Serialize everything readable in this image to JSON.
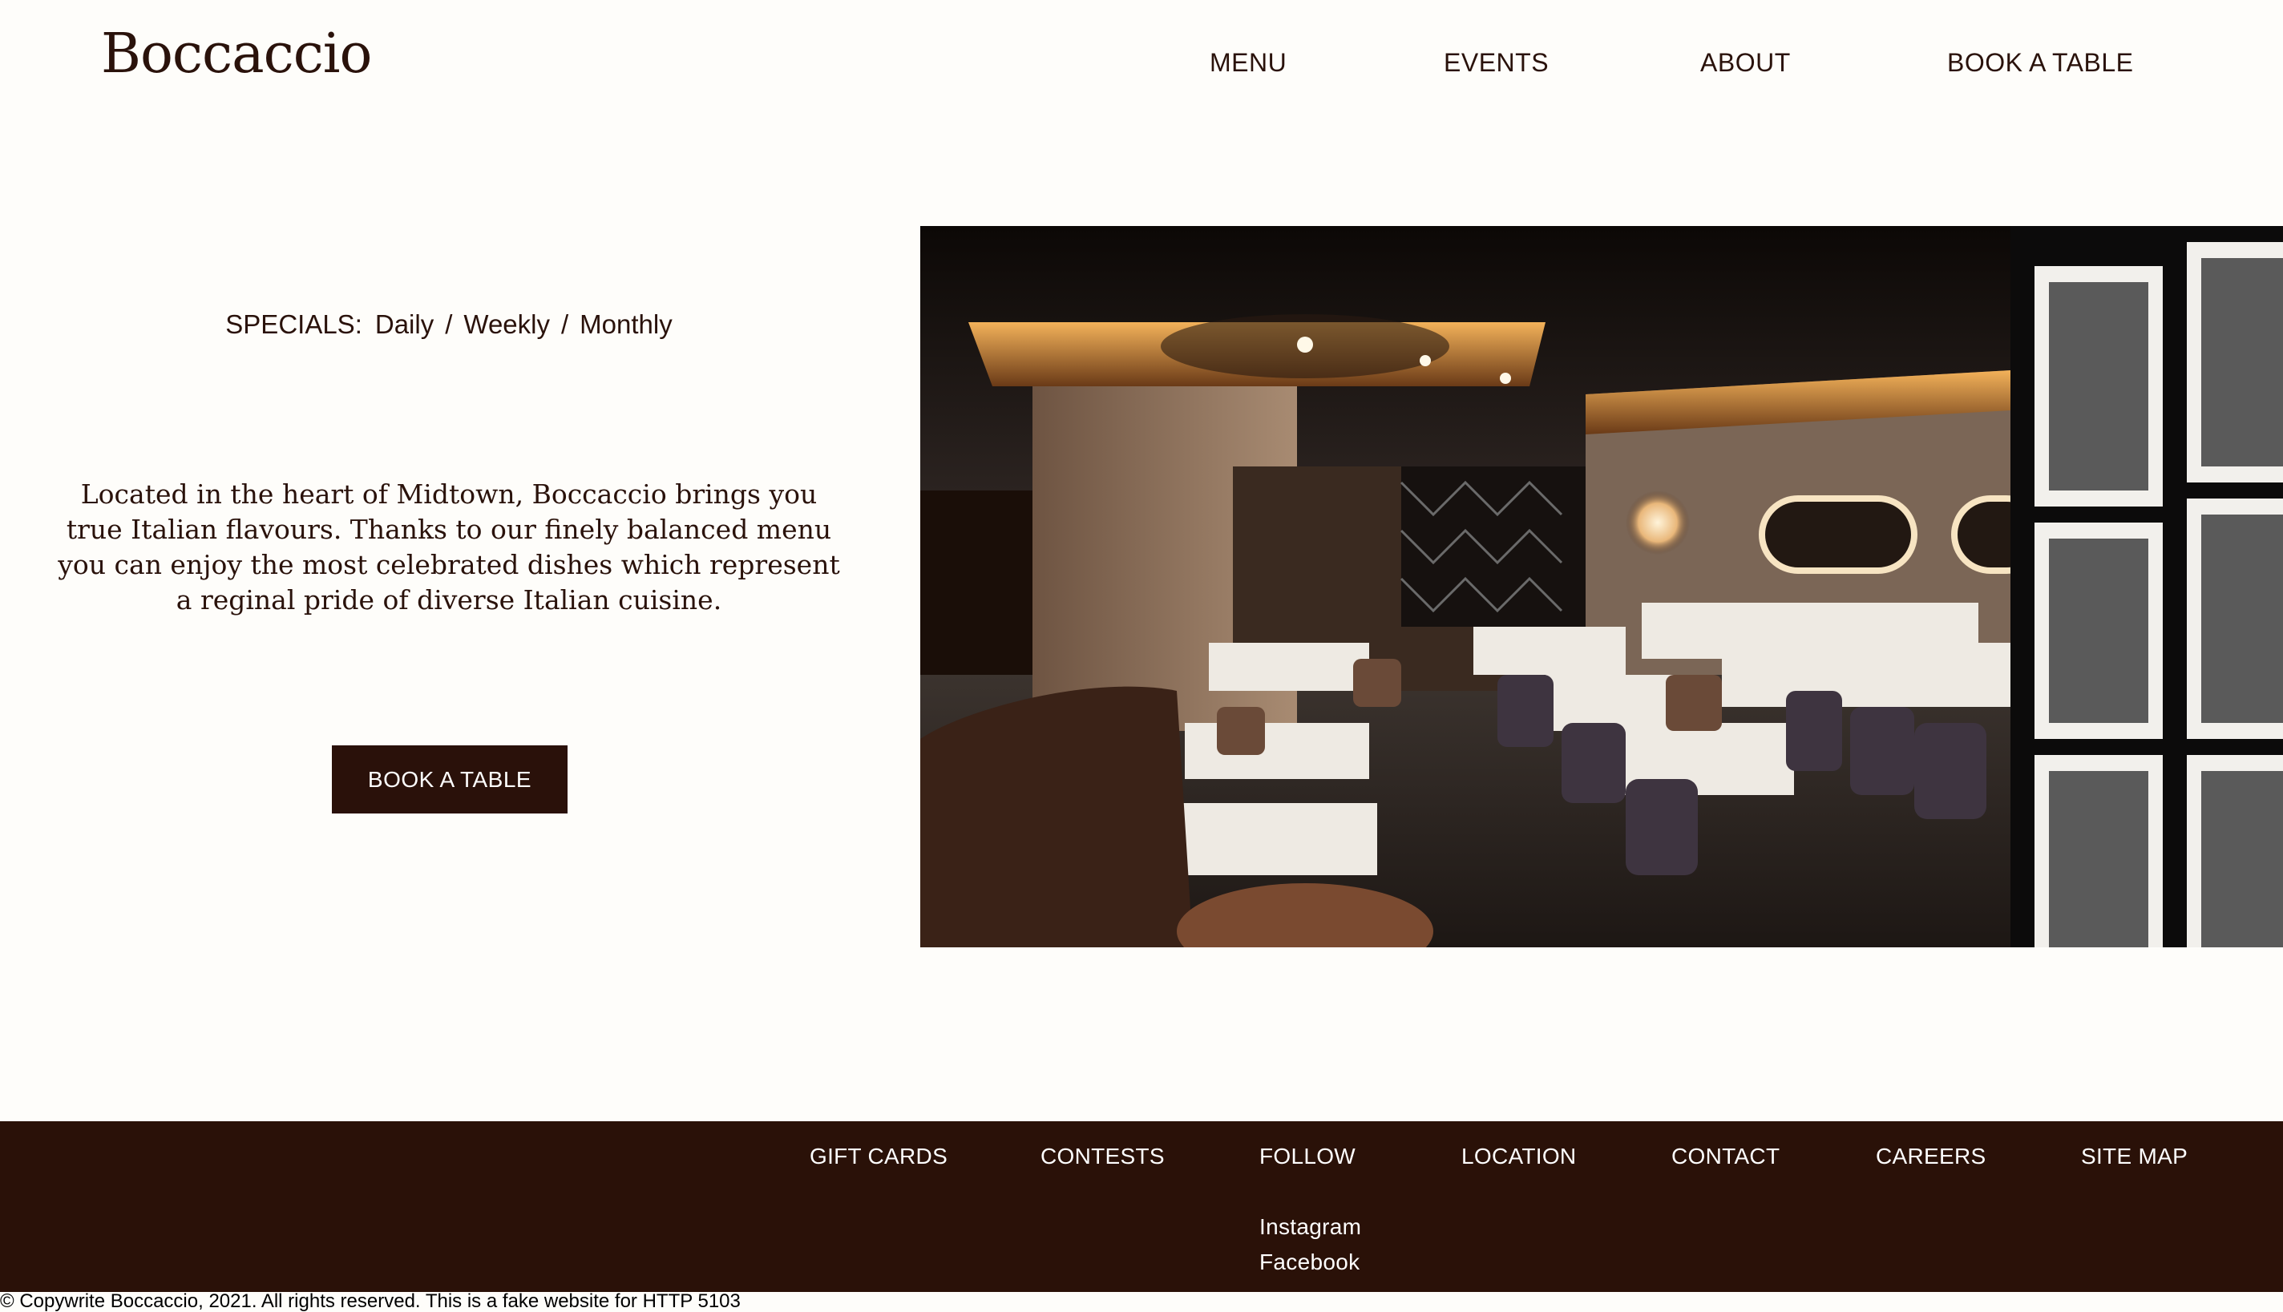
{
  "header": {
    "logo": "Boccaccio",
    "nav": [
      {
        "label": "MENU"
      },
      {
        "label": "EVENTS"
      },
      {
        "label": "ABOUT"
      },
      {
        "label": "BOOK A TABLE"
      }
    ]
  },
  "main": {
    "specials_label": "SPECIALS:",
    "specials": [
      {
        "label": "Daily"
      },
      {
        "label": "Weekly"
      },
      {
        "label": "Monthly"
      }
    ],
    "separator": "/",
    "intro": "Located in the heart of Midtown, Boccaccio brings you true Italian flavours. Thanks to our finely balanced menu you can enjoy the most celebrated dishes which represent a reginal pride of diverse Italian cuisine.",
    "cta_label": "BOOK A TABLE"
  },
  "footer": {
    "links": [
      {
        "label": "GIFT CARDS"
      },
      {
        "label": "CONTESTS"
      },
      {
        "label": "FOLLOW"
      },
      {
        "label": "LOCATION"
      },
      {
        "label": "CONTACT"
      },
      {
        "label": "CAREERS"
      },
      {
        "label": "SITE MAP"
      }
    ],
    "social": [
      {
        "label": "Instagram"
      },
      {
        "label": "Facebook"
      }
    ],
    "copyright": "© Copywrite Boccaccio, 2021. All rights reserved. This is a fake website for HTTP 5103"
  },
  "colors": {
    "background": "#fefdfa",
    "brand_dark": "#2a110a",
    "text": "#2a120b"
  }
}
